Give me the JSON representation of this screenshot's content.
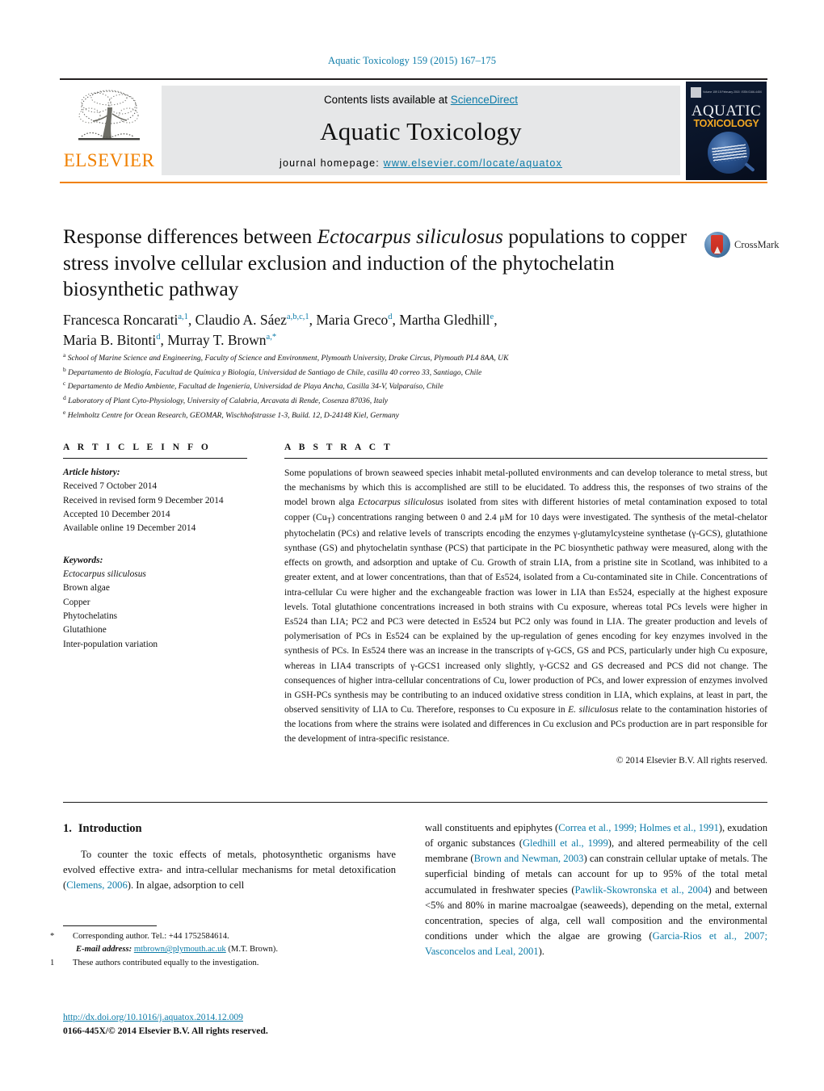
{
  "running_head": "Aquatic Toxicology 159 (2015) 167–175",
  "masthead": {
    "elsevier_wordmark": "ELSEVIER",
    "contents_prefix": "Contents lists available at ",
    "contents_link": "ScienceDirect",
    "journal_name": "Aquatic Toxicology",
    "homepage_prefix": "journal homepage: ",
    "homepage_url": "www.elsevier.com/locate/aquatox",
    "cover": {
      "title_top": "AQUATIC",
      "title_bottom": "TOXICOLOGY",
      "tiny_left": "Volume 159  15 February 2015",
      "tiny_right": "ISSN 0166-445X"
    }
  },
  "crossmark": {
    "label": "CrossMark"
  },
  "title": {
    "line1_a": "Response differences between ",
    "line1_i": "Ectocarpus siliculosus",
    "line1_b": " populations to",
    "line2": "copper stress involve cellular exclusion and induction of the",
    "line3": "phytochelatin biosynthetic pathway"
  },
  "authors": {
    "list": [
      {
        "name": "Francesca Roncarati",
        "marks": "a,1",
        "sep": ", "
      },
      {
        "name": "Claudio A. Sáez",
        "marks": "a,b,c,1",
        "sep": ", "
      },
      {
        "name": "Maria Greco",
        "marks": "d",
        "sep": ", "
      },
      {
        "name": "Martha Gledhill",
        "marks": "e",
        "sep": ","
      },
      {
        "name": "Maria B. Bitonti",
        "marks": "d",
        "sep": ", "
      },
      {
        "name": "Murray T. Brown",
        "marks": "a,*",
        "sep": ""
      }
    ]
  },
  "affiliations": [
    {
      "mark": "a",
      "text": "School of Marine Science and Engineering, Faculty of Science and Environment, Plymouth University, Drake Circus, Plymouth PL4 8AA, UK"
    },
    {
      "mark": "b",
      "text": "Departamento de Biología, Facultad de Química y Biología, Universidad de Santiago de Chile, casilla 40 correo 33, Santiago, Chile"
    },
    {
      "mark": "c",
      "text": "Departamento de Medio Ambiente, Facultad de Ingeniería, Universidad de Playa Ancha, Casilla 34-V, Valparaíso, Chile"
    },
    {
      "mark": "d",
      "text": "Laboratory of Plant Cyto-Physiology, University of Calabria, Arcavata di Rende, Cosenza 87036, Italy"
    },
    {
      "mark": "e",
      "text": "Helmholtz Centre for Ocean Research, GEOMAR, Wischhofstrasse 1-3, Build. 12, D-24148 Kiel, Germany"
    }
  ],
  "article_info": {
    "heading": "A R T I C L E    I N F O",
    "history_label": "Article history:",
    "history": [
      "Received 7 October 2014",
      "Received in revised form 9 December 2014",
      "Accepted 10 December 2014",
      "Available online 19 December 2014"
    ],
    "keywords_label": "Keywords:",
    "keywords": [
      "Ectocarpus siliculosus",
      "Brown algae",
      "Copper",
      "Phytochelatins",
      "Glutathione",
      "Inter-population variation"
    ],
    "keyword_italic_index": 0
  },
  "abstract": {
    "heading": "A B S T R A C T",
    "paragraph_parts": [
      {
        "t": "Some populations of brown seaweed species inhabit metal-polluted environments and can develop tolerance to metal stress, but the mechanisms by which this is accomplished are still to be elucidated. To address this, the responses of two strains of the model brown alga "
      },
      {
        "t": "Ectocarpus siliculosus",
        "i": true
      },
      {
        "t": " isolated from sites with different histories of metal contamination exposed to total copper (Cu"
      },
      {
        "t": "T",
        "sub": true
      },
      {
        "t": ") concentrations ranging between 0 and 2.4 μM for 10 days were investigated. The synthesis of the metal-chelator phytochelatin (PCs) and relative levels of transcripts encoding the enzymes γ-glutamylcysteine synthetase (γ-GCS), glutathione synthase (GS) and phytochelatin synthase (PCS) that participate in the PC biosynthetic pathway were measured, along with the effects on growth, and adsorption and uptake of Cu. Growth of strain LIA, from a pristine site in Scotland, was inhibited to a greater extent, and at lower concentrations, than that of Es524, isolated from a Cu-contaminated site in Chile. Concentrations of intra-cellular Cu were higher and the exchangeable fraction was lower in LIA than Es524, especially at the highest exposure levels. Total glutathione concentrations increased in both strains with Cu exposure, whereas total PCs levels were higher in Es524 than LIA; PC2 and PC3 were detected in Es524 but PC2 only was found in LIA. The greater production and levels of polymerisation of PCs in Es524 can be explained by the up-regulation of genes encoding for key enzymes involved in the synthesis of PCs. In Es524 there was an increase in the transcripts of γ-GCS, GS and PCS, particularly under high Cu exposure, whereas in LIA4 transcripts of γ-GCS1 increased only slightly, γ-GCS2 and GS decreased and PCS did not change. The consequences of higher intra-cellular concentrations of Cu, lower production of PCs, and lower expression of enzymes involved in GSH-PCs synthesis may be contributing to an induced oxidative stress condition in LIA, which explains, at least in part, the observed sensitivity of LIA to Cu. Therefore, responses to Cu exposure in "
      },
      {
        "t": "E. siliculosus",
        "i": true
      },
      {
        "t": " relate to the contamination histories of the locations from where the strains were isolated and differences in Cu exclusion and PCs production are in part responsible for the development of intra-specific resistance."
      }
    ],
    "copyright": "© 2014 Elsevier B.V. All rights reserved."
  },
  "introduction": {
    "number": "1.",
    "heading": "Introduction",
    "left_parts": [
      {
        "t": "To counter the toxic effects of metals, photosynthetic organisms have evolved effective extra- and intra-cellular mechanisms for metal detoxification ("
      },
      {
        "t": "Clemens, 2006",
        "ref": true
      },
      {
        "t": "). In algae, adsorption to cell"
      }
    ],
    "right_parts": [
      {
        "t": "wall constituents and epiphytes ("
      },
      {
        "t": "Correa et al., 1999; Holmes et al., 1991",
        "ref": true
      },
      {
        "t": "), exudation of organic substances ("
      },
      {
        "t": "Gledhill et al., 1999",
        "ref": true
      },
      {
        "t": "), and altered permeability of the cell membrane ("
      },
      {
        "t": "Brown and Newman, 2003",
        "ref": true
      },
      {
        "t": ") can constrain cellular uptake of metals. The superficial binding of metals can account for up to 95% of the total metal accumulated in freshwater species ("
      },
      {
        "t": "Pawlik-Skowronska et al., 2004",
        "ref": true
      },
      {
        "t": ") and between <5% and 80% in marine macroalgae (seaweeds), depending on the metal, external concentration, species of alga, cell wall composition and the environmental conditions under which the algae are growing ("
      },
      {
        "t": "Garcia-Rios et al., 2007; Vasconcelos and Leal, 2001",
        "ref": true
      },
      {
        "t": ")."
      }
    ]
  },
  "footnotes": {
    "corresponding": {
      "mark": "*",
      "text": "Corresponding author. Tel.: +44 1752584614."
    },
    "email": {
      "label": "E-mail address:",
      "address": "mtbrown@plymouth.ac.uk",
      "suffix": "(M.T. Brown)."
    },
    "equal": {
      "mark": "1",
      "text": "These authors contributed equally to the investigation."
    }
  },
  "doi_block": {
    "doi": "http://dx.doi.org/10.1016/j.aquatox.2014.12.009",
    "issn": "0166-445X/© 2014 Elsevier B.V. All rights reserved."
  },
  "colors": {
    "link": "#0b7ba8",
    "elsevier_orange": "#f08000",
    "band_gray": "#e6e7e8"
  }
}
